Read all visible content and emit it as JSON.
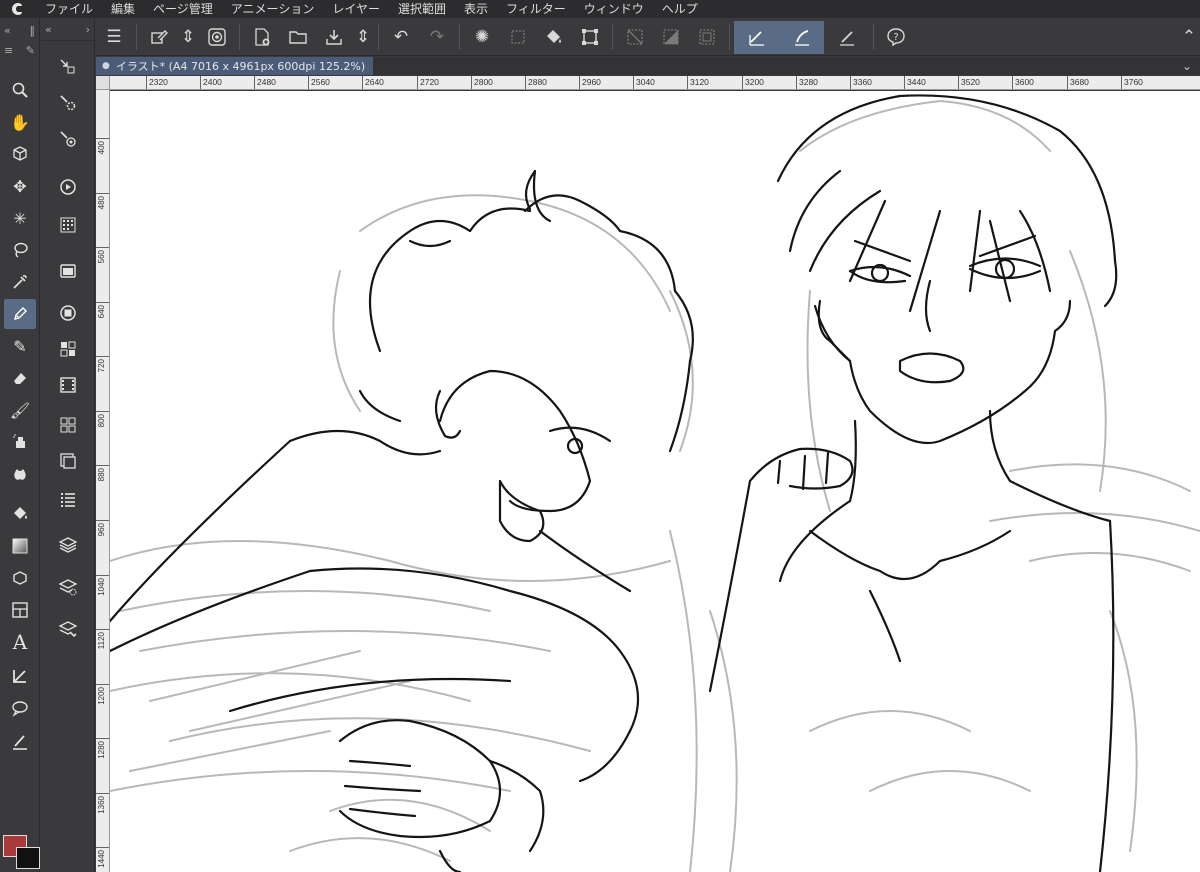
{
  "menu": {
    "items": [
      "ファイル",
      "編集",
      "ページ管理",
      "アニメーション",
      "レイヤー",
      "選択範囲",
      "表示",
      "フィルター",
      "ウィンドウ",
      "ヘルプ"
    ]
  },
  "document": {
    "tab_label": "イラスト* (A4 7016 x 4961px 600dpi 125.2%)"
  },
  "rulers": {
    "horizontal": [
      "2320",
      "2400",
      "2480",
      "2560",
      "2640",
      "2720",
      "2800",
      "2880",
      "2960",
      "3040",
      "3120",
      "3200",
      "3280",
      "3360",
      "3440",
      "3520",
      "3600",
      "3680",
      "3760"
    ],
    "vertical": [
      "400",
      "480",
      "560",
      "640",
      "720",
      "800",
      "880",
      "960",
      "1040",
      "1120",
      "1200",
      "1280",
      "1360",
      "1440"
    ]
  },
  "colors": {
    "main_color": "#a83a3a",
    "sub_color": "#111111",
    "active_highlight": "#5a6b86",
    "tab_bg": "#4b5c79"
  },
  "tools": [
    "zoom-icon",
    "hand-icon",
    "object-icon",
    "move-icon",
    "auto-select-icon",
    "lasso-icon",
    "eyedropper-icon",
    "pen-icon",
    "pencil-icon",
    "eraser-icon",
    "brush-icon",
    "airbrush-icon",
    "blend-icon",
    "fill-icon",
    "gradient-icon",
    "figure-icon",
    "frame-icon",
    "text-icon",
    "balloon-tail-icon",
    "balloon-icon",
    "line-correction-icon"
  ],
  "subtools": [
    "subtool-operation-icon",
    "subtool-settings-icon",
    "subtool-target-icon",
    "navigator-icon",
    "color-set-icon",
    "layer-property-icon",
    "intermediate-color-icon",
    "color-slider-icon",
    "timeline-icon",
    "material-icon",
    "layer-search-icon",
    "history-icon",
    "layer-icon",
    "auto-action-icon",
    "animation-cel-icon"
  ]
}
